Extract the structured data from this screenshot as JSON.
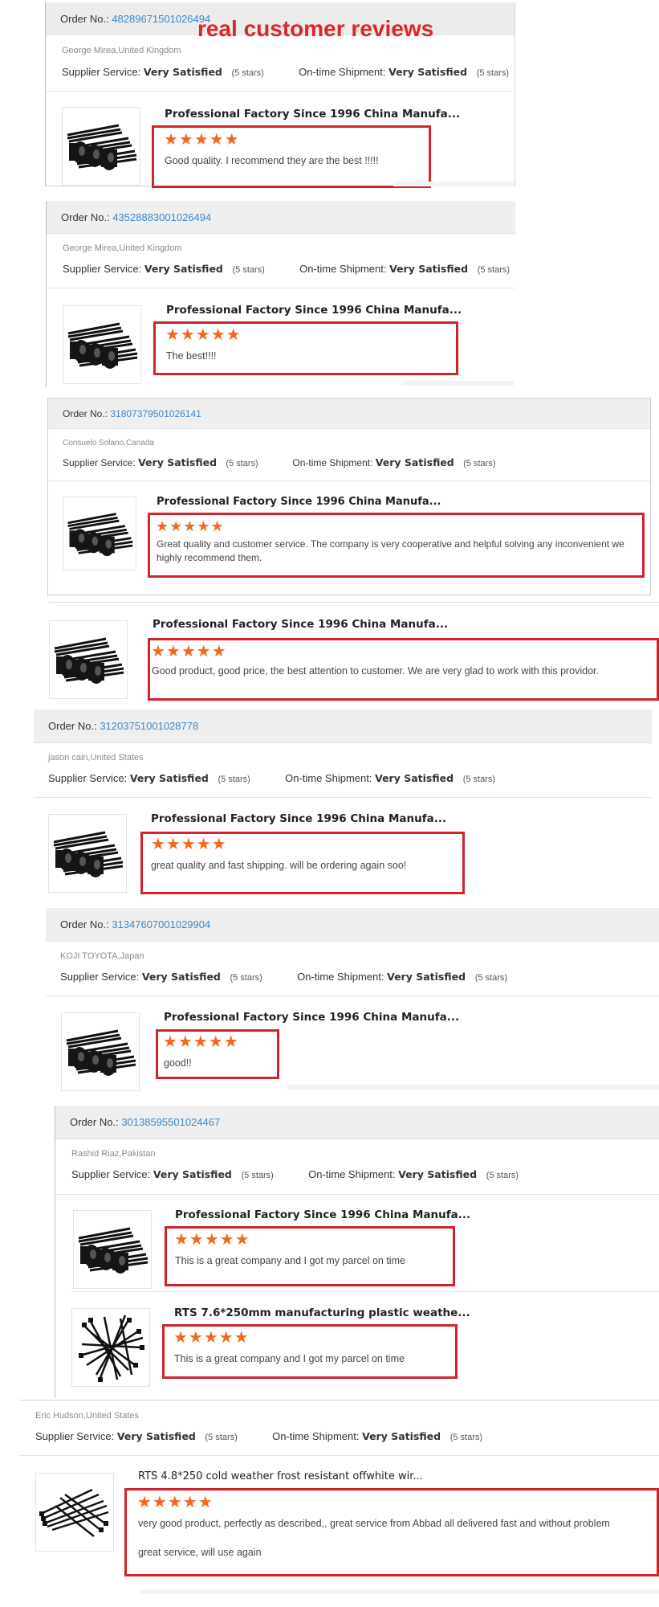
{
  "banner": "real customer reviews",
  "labels": {
    "order_no": "Order No.:",
    "supplier_service": "Supplier Service:",
    "ontime_shipment": "On-time Shipment:",
    "very_satisfied": "Very Satisfied",
    "five_stars": "(5 stars)"
  },
  "colors": {
    "accent_red": "#d1232a",
    "star_orange": "#f2681e",
    "link_blue": "#3a87c8"
  },
  "reviews": [
    {
      "order_no": "48289671501026494",
      "buyer": "George Mirea,United Kingdom",
      "items": [
        {
          "title": "Professional Factory Since 1996 China Manufa...",
          "stars": 5,
          "review": "Good quality.  I recommend they are the best !!!!!"
        }
      ]
    },
    {
      "order_no": "43528883001026494",
      "buyer": "George Mirea,United Kingdom",
      "items": [
        {
          "title": "Professional Factory Since 1996 China Manufa...",
          "stars": 5,
          "review": "The best!!!!"
        }
      ]
    },
    {
      "order_no": "31807379501026141",
      "buyer": "Consuelo Solano,Canada",
      "items": [
        {
          "title": "Professional Factory Since 1996 China Manufa...",
          "stars": 5,
          "review": "Great quality and customer service. The company is very cooperative and helpful solving any inconvenient we highly recommend them."
        }
      ]
    },
    {
      "order_no": "",
      "buyer": "",
      "items": [
        {
          "title": "Professional Factory Since 1996 China Manufa...",
          "stars": 5,
          "review": "Good product, good price, the best attention to customer. We are very glad to work with this providor."
        }
      ]
    },
    {
      "order_no": "31203751001028778",
      "buyer": "jason cain,United States",
      "items": [
        {
          "title": "Professional Factory Since 1996 China Manufa...",
          "stars": 5,
          "review": "great quality and fast shipping. will be ordering again soo!"
        }
      ]
    },
    {
      "order_no": "31347607001029904",
      "buyer": "KOJI TOYOTA,Japan",
      "items": [
        {
          "title": "Professional Factory Since 1996 China Manufa...",
          "stars": 5,
          "review": "good!!"
        }
      ]
    },
    {
      "order_no": "30138595501024467",
      "buyer": "Rashid Riaz,Pakistan",
      "items": [
        {
          "title": "Professional Factory Since 1996 China Manufa...",
          "stars": 5,
          "review": "This is a great company and I got my parcel on time"
        },
        {
          "title": "RTS 7.6*250mm manufacturing plastic weathe...",
          "stars": 5,
          "review": "This is a great company and I got my parcel on time"
        }
      ]
    },
    {
      "order_no": "",
      "buyer": "Eric Hudson,United States",
      "items": [
        {
          "title": "RTS 4.8*250 cold weather frost resistant offwhite wir...",
          "stars": 5,
          "review_line1": "very good product, perfectly as described,, great service from Abbad all delivered fast and without problem",
          "review_line2": "great service, will use again"
        }
      ]
    }
  ]
}
